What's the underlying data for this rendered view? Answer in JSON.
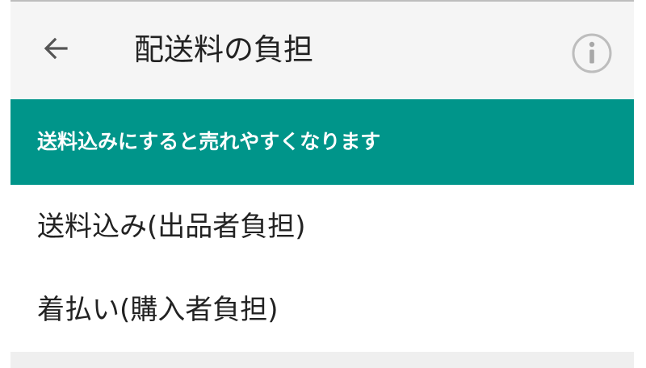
{
  "header": {
    "title": "配送料の負担",
    "back_icon": "arrow-left-icon",
    "info_icon": "info-circle-icon"
  },
  "banner": {
    "text": "送料込みにすると売れやすくなります",
    "color": "#00958a"
  },
  "options": [
    {
      "label": "送料込み(出品者負担)"
    },
    {
      "label": "着払い(購入者負担)"
    }
  ]
}
